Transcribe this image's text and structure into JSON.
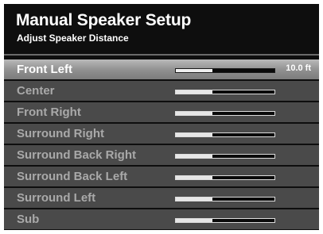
{
  "header": {
    "title": "Manual Speaker Setup",
    "subtitle": "Adjust Speaker Distance"
  },
  "speakers": [
    {
      "label": "Front Left",
      "level": 0.37,
      "value": "10.0 ft",
      "selected": true
    },
    {
      "label": "Center",
      "level": 0.37,
      "value": "",
      "selected": false
    },
    {
      "label": "Front Right",
      "level": 0.37,
      "value": "",
      "selected": false
    },
    {
      "label": "Surround Right",
      "level": 0.37,
      "value": "",
      "selected": false
    },
    {
      "label": "Surround Back Right",
      "level": 0.37,
      "value": "",
      "selected": false
    },
    {
      "label": "Surround Back Left",
      "level": 0.37,
      "value": "",
      "selected": false
    },
    {
      "label": "Surround Left",
      "level": 0.37,
      "value": "",
      "selected": false
    },
    {
      "label": "Sub",
      "level": 0.37,
      "value": "",
      "selected": false
    }
  ],
  "colors": {
    "background": "#0e0e0e",
    "row": "#4a4a4a",
    "selected_row": "#a5a5a5",
    "label": "#a9a9a9",
    "selected_label": "#ffffff"
  }
}
